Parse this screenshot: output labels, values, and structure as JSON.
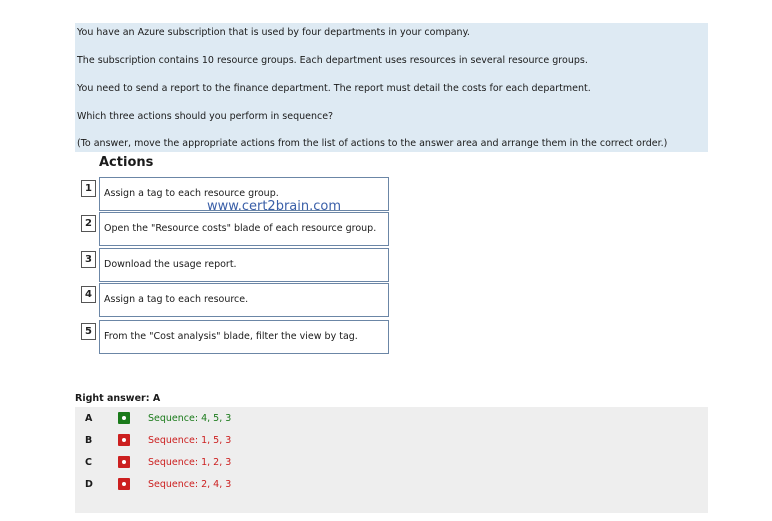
{
  "question": {
    "lines": [
      "You have an Azure subscription that is used by four departments in your company.",
      "The subscription contains 10 resource groups. Each department uses resources in several resource groups.",
      "You need to send a report to the finance department. The report must detail the costs for each department.",
      "Which three actions should you perform in sequence?",
      "(To answer, move the appropriate actions from the list of actions to the answer area and arrange them in the correct order.)"
    ]
  },
  "actions": {
    "title": "Actions",
    "items": [
      {
        "num": "1",
        "text": "Assign a tag to each resource group."
      },
      {
        "num": "2",
        "text": "Open the \"Resource costs\" blade of each resource group."
      },
      {
        "num": "3",
        "text": "Download the usage report."
      },
      {
        "num": "4",
        "text": "Assign a tag to each resource."
      },
      {
        "num": "5",
        "text": "From the \"Cost analysis\" blade, filter the view by tag."
      }
    ]
  },
  "watermark": "www.cert2brain.com",
  "answer": {
    "label": "Right answer: A",
    "options": [
      {
        "letter": "A",
        "text": "Sequence: 4, 5, 3",
        "correct": true,
        "color": "#1a7a1a"
      },
      {
        "letter": "B",
        "text": "Sequence: 1, 5, 3",
        "correct": false,
        "color": "#cc1f1f"
      },
      {
        "letter": "C",
        "text": "Sequence: 1, 2, 3",
        "correct": false,
        "color": "#cc1f1f"
      },
      {
        "letter": "D",
        "text": "Sequence: 2, 4, 3",
        "correct": false,
        "color": "#cc1f1f"
      }
    ]
  }
}
